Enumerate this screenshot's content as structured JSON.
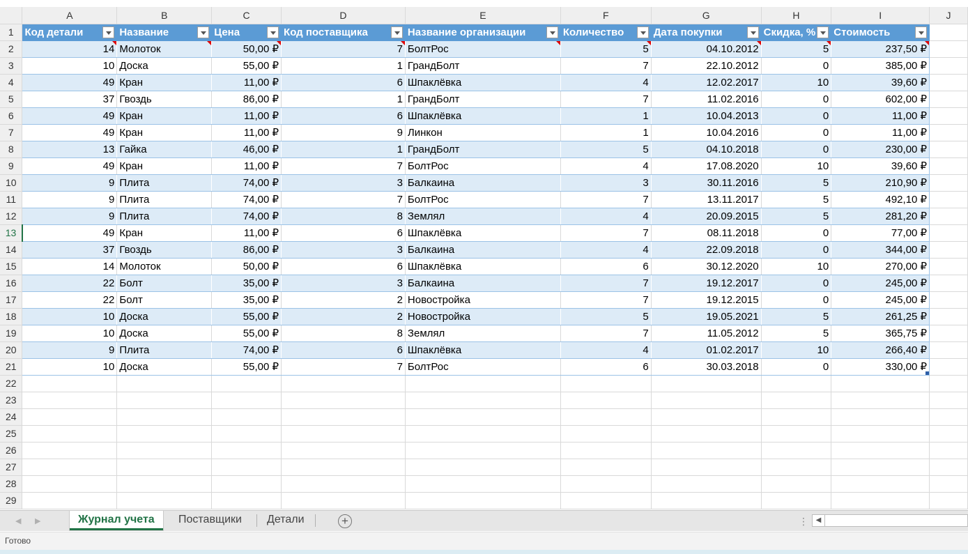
{
  "columns": [
    "A",
    "B",
    "C",
    "D",
    "E",
    "F",
    "G",
    "H",
    "I",
    "J"
  ],
  "headers": [
    "Код детали",
    "Название",
    "Цена",
    "Код поставщика",
    "Название организации",
    "Количество",
    "Дата покупки",
    "Скидка, %",
    "Стоимость"
  ],
  "rows": [
    [
      "14",
      "Молоток",
      "50,00 ₽",
      "7",
      "БолтРос",
      "5",
      "04.10.2012",
      "5",
      "237,50 ₽"
    ],
    [
      "10",
      "Доска",
      "55,00 ₽",
      "1",
      "ГрандБолт",
      "7",
      "22.10.2012",
      "0",
      "385,00 ₽"
    ],
    [
      "49",
      "Кран",
      "11,00 ₽",
      "6",
      "Шпаклёвка",
      "4",
      "12.02.2017",
      "10",
      "39,60 ₽"
    ],
    [
      "37",
      "Гвоздь",
      "86,00 ₽",
      "1",
      "ГрандБолт",
      "7",
      "11.02.2016",
      "0",
      "602,00 ₽"
    ],
    [
      "49",
      "Кран",
      "11,00 ₽",
      "6",
      "Шпаклёвка",
      "1",
      "10.04.2013",
      "0",
      "11,00 ₽"
    ],
    [
      "49",
      "Кран",
      "11,00 ₽",
      "9",
      "Линкон",
      "1",
      "10.04.2016",
      "0",
      "11,00 ₽"
    ],
    [
      "13",
      "Гайка",
      "46,00 ₽",
      "1",
      "ГрандБолт",
      "5",
      "04.10.2018",
      "0",
      "230,00 ₽"
    ],
    [
      "49",
      "Кран",
      "11,00 ₽",
      "7",
      "БолтРос",
      "4",
      "17.08.2020",
      "10",
      "39,60 ₽"
    ],
    [
      "9",
      "Плита",
      "74,00 ₽",
      "3",
      "Балкаина",
      "3",
      "30.11.2016",
      "5",
      "210,90 ₽"
    ],
    [
      "9",
      "Плита",
      "74,00 ₽",
      "7",
      "БолтРос",
      "7",
      "13.11.2017",
      "5",
      "492,10 ₽"
    ],
    [
      "9",
      "Плита",
      "74,00 ₽",
      "8",
      "Землял",
      "4",
      "20.09.2015",
      "5",
      "281,20 ₽"
    ],
    [
      "49",
      "Кран",
      "11,00 ₽",
      "6",
      "Шпаклёвка",
      "7",
      "08.11.2018",
      "0",
      "77,00 ₽"
    ],
    [
      "37",
      "Гвоздь",
      "86,00 ₽",
      "3",
      "Балкаина",
      "4",
      "22.09.2018",
      "0",
      "344,00 ₽"
    ],
    [
      "14",
      "Молоток",
      "50,00 ₽",
      "6",
      "Шпаклёвка",
      "6",
      "30.12.2020",
      "10",
      "270,00 ₽"
    ],
    [
      "22",
      "Болт",
      "35,00 ₽",
      "3",
      "Балкаина",
      "7",
      "19.12.2017",
      "0",
      "245,00 ₽"
    ],
    [
      "22",
      "Болт",
      "35,00 ₽",
      "2",
      "Новостройка",
      "7",
      "19.12.2015",
      "0",
      "245,00 ₽"
    ],
    [
      "10",
      "Доска",
      "55,00 ₽",
      "2",
      "Новостройка",
      "5",
      "19.05.2021",
      "5",
      "261,25 ₽"
    ],
    [
      "10",
      "Доска",
      "55,00 ₽",
      "8",
      "Землял",
      "7",
      "11.05.2012",
      "5",
      "365,75 ₽"
    ],
    [
      "9",
      "Плита",
      "74,00 ₽",
      "6",
      "Шпаклёвка",
      "4",
      "01.02.2017",
      "10",
      "266,40 ₽"
    ],
    [
      "10",
      "Доска",
      "55,00 ₽",
      "7",
      "БолтРос",
      "6",
      "30.03.2018",
      "0",
      "330,00 ₽"
    ]
  ],
  "row_numbers": [
    "1",
    "2",
    "3",
    "4",
    "5",
    "6",
    "7",
    "8",
    "9",
    "10",
    "11",
    "12",
    "13",
    "14",
    "15",
    "16",
    "17",
    "18",
    "19",
    "20",
    "21",
    "22",
    "23",
    "24",
    "25",
    "26",
    "27",
    "28",
    "29"
  ],
  "selected_row": "13",
  "sheet_tabs": [
    "Журнал учета",
    "Поставщики",
    "Детали"
  ],
  "active_tab": "Журнал учета",
  "add_sheet_symbol": "+",
  "status": "Готово",
  "colors": {
    "accent": "#217346",
    "header_fill": "#5b9bd5",
    "band_fill": "#ddebf7",
    "comment_marker": "#e00000"
  }
}
